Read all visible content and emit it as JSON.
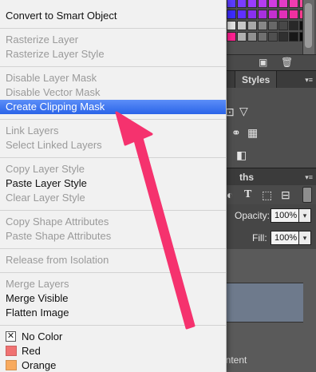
{
  "menu": {
    "groups": [
      {
        "items": [
          {
            "label": "Convert to Smart Object",
            "enabled": true,
            "highlighted": false
          }
        ]
      },
      {
        "items": [
          {
            "label": "Rasterize Layer",
            "enabled": false,
            "highlighted": false
          },
          {
            "label": "Rasterize Layer Style",
            "enabled": false,
            "highlighted": false
          }
        ]
      },
      {
        "items": [
          {
            "label": "Disable Layer Mask",
            "enabled": false,
            "highlighted": false
          },
          {
            "label": "Disable Vector Mask",
            "enabled": false,
            "highlighted": false
          },
          {
            "label": "Create Clipping Mask",
            "enabled": true,
            "highlighted": true
          }
        ]
      },
      {
        "items": [
          {
            "label": "Link Layers",
            "enabled": false,
            "highlighted": false
          },
          {
            "label": "Select Linked Layers",
            "enabled": false,
            "highlighted": false
          }
        ]
      },
      {
        "items": [
          {
            "label": "Copy Layer Style",
            "enabled": false,
            "highlighted": false
          },
          {
            "label": "Paste Layer Style",
            "enabled": true,
            "highlighted": false
          },
          {
            "label": "Clear Layer Style",
            "enabled": false,
            "highlighted": false
          }
        ]
      },
      {
        "items": [
          {
            "label": "Copy Shape Attributes",
            "enabled": false,
            "highlighted": false
          },
          {
            "label": "Paste Shape Attributes",
            "enabled": false,
            "highlighted": false
          }
        ]
      },
      {
        "items": [
          {
            "label": "Release from Isolation",
            "enabled": false,
            "highlighted": false
          }
        ]
      },
      {
        "items": [
          {
            "label": "Merge Layers",
            "enabled": false,
            "highlighted": false
          },
          {
            "label": "Merge Visible",
            "enabled": true,
            "highlighted": false
          },
          {
            "label": "Flatten Image",
            "enabled": true,
            "highlighted": false
          }
        ]
      }
    ],
    "colors": [
      {
        "label": "No Color",
        "swatch": "none"
      },
      {
        "label": "Red",
        "swatch": "#f07272"
      },
      {
        "label": "Orange",
        "swatch": "#f8aa5e"
      }
    ]
  },
  "panels": {
    "styles_tab": "Styles",
    "layers_tab_fragment": "ths",
    "opacity_label": "Opacity:",
    "opacity_value": "100%",
    "fill_label": "Fill:",
    "fill_value": "100%",
    "layer_name_fragment": "ontent"
  },
  "colors": {
    "highlight": "#3a74f0",
    "annotation_arrow": "#f5326e",
    "menu_bg": "#f1f1f1"
  }
}
